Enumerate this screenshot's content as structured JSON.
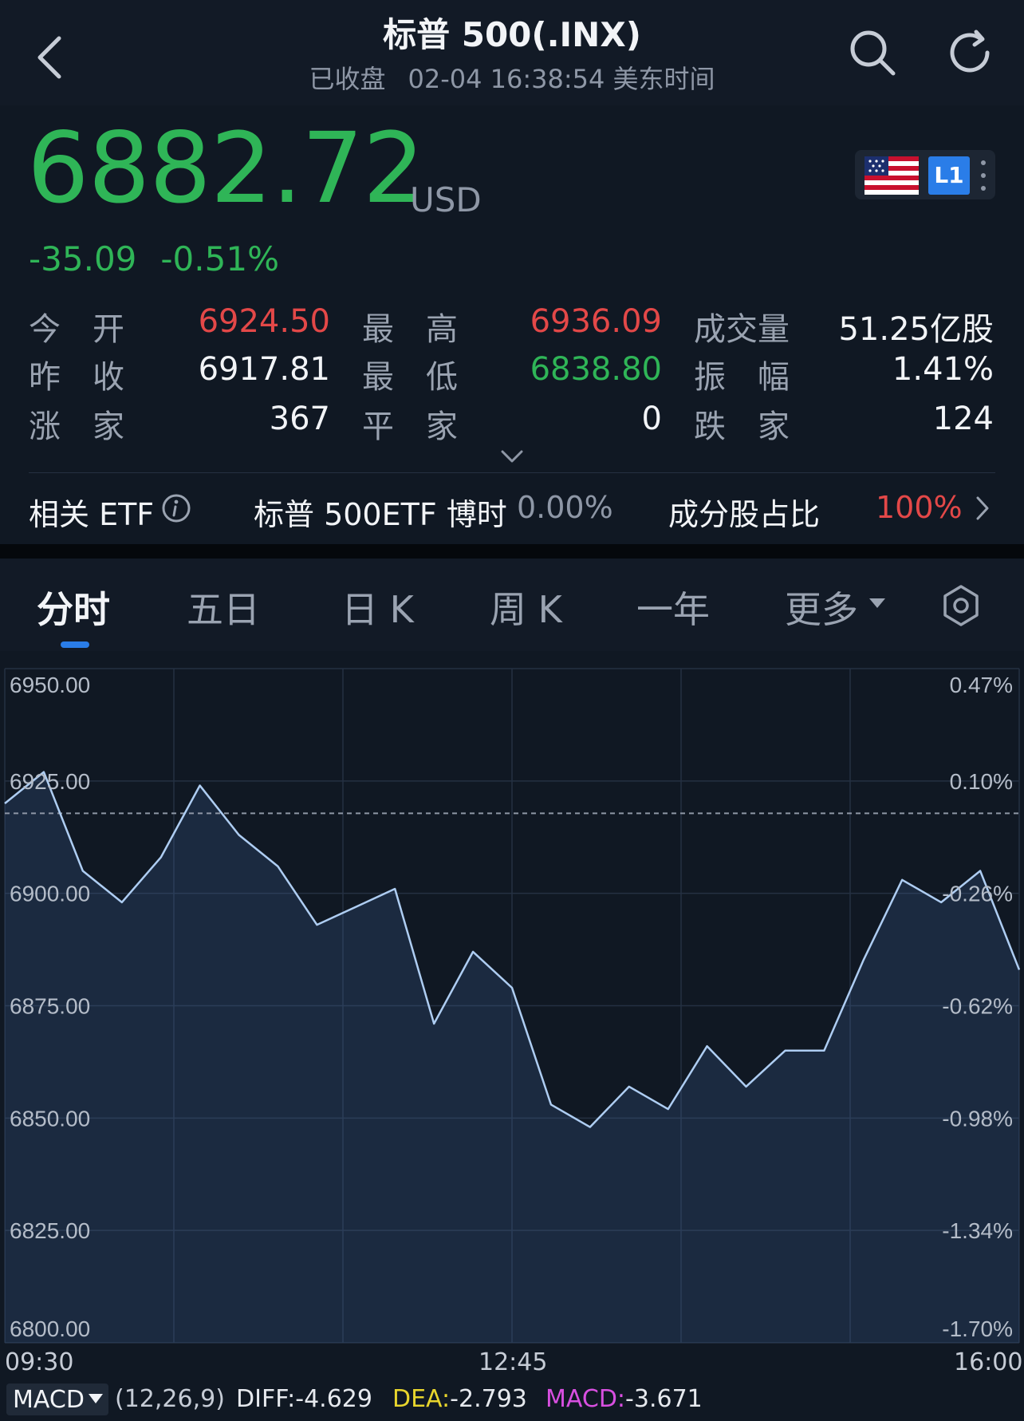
{
  "header": {
    "title": "标普 500(.INX)",
    "status": "已收盘",
    "datetime": "02-04 16:38:54 美东时间"
  },
  "quote": {
    "price": "6882.72",
    "currency": "USD",
    "change": "-35.09",
    "change_pct": "-0.51%",
    "level_badge": "L1"
  },
  "stats": [
    [
      {
        "label": "今　开",
        "value": "6924.50",
        "color": "red"
      },
      {
        "label": "最　高",
        "value": "6936.09",
        "color": "red"
      },
      {
        "label": "成交量",
        "value": "51.25亿股",
        "color": "white"
      }
    ],
    [
      {
        "label": "昨　收",
        "value": "6917.81",
        "color": "white"
      },
      {
        "label": "最　低",
        "value": "6838.80",
        "color": "green"
      },
      {
        "label": "振　幅",
        "value": "1.41%",
        "color": "white"
      }
    ],
    [
      {
        "label": "涨　家",
        "value": "367",
        "color": "white"
      },
      {
        "label": "平　家",
        "value": "0",
        "color": "white"
      },
      {
        "label": "跌　家",
        "value": "124",
        "color": "white"
      }
    ]
  ],
  "etf": {
    "label": "相关 ETF",
    "name": "标普 500ETF 博时",
    "name_pct": "0.00%",
    "weight_label": "成分股占比",
    "weight_value": "100%"
  },
  "tabs": [
    "分时",
    "五日",
    "日 K",
    "周 K",
    "一年",
    "更多"
  ],
  "colors": {
    "up": "#e34848",
    "down": "#2fb557",
    "accent": "#2a7de8",
    "line": "#aecdf2"
  },
  "icons": [
    "back-chevron-icon",
    "search-icon",
    "refresh-icon",
    "us-flag-icon",
    "kebab-icon",
    "chevron-down-icon",
    "info-icon",
    "chevron-right-icon",
    "settings-icon",
    "dropdown-arrow-icon"
  ],
  "chart_data": {
    "type": "line",
    "ylim": [
      6800,
      6950
    ],
    "y_ticks_left": [
      "6950.00",
      "6925.00",
      "6900.00",
      "6875.00",
      "6850.00",
      "6825.00",
      "6800.00"
    ],
    "y_ticks_right": [
      "0.47%",
      "0.10%",
      "-0.26%",
      "-0.62%",
      "-0.98%",
      "-1.34%",
      "-1.70%"
    ],
    "prev_close": 6917.81,
    "x_labels": [
      "09:30",
      "12:45",
      "16:00"
    ],
    "series": [
      {
        "x": [
          "09:30",
          "09:45",
          "10:00",
          "10:15",
          "10:30",
          "10:45",
          "11:00",
          "11:15",
          "11:30",
          "11:45",
          "12:00",
          "12:15",
          "12:30",
          "12:45",
          "13:00",
          "13:15",
          "13:30",
          "13:45",
          "14:00",
          "14:15",
          "14:30",
          "14:45",
          "15:00",
          "15:15",
          "15:30",
          "15:45",
          "16:00"
        ],
        "values": [
          6920,
          6927,
          6905,
          6898,
          6908,
          6924,
          6913,
          6906,
          6893,
          6897,
          6901,
          6871,
          6887,
          6879,
          6853,
          6848,
          6857,
          6852,
          6866,
          6857,
          6865,
          6865,
          6885,
          6903,
          6898,
          6905,
          6883
        ]
      }
    ]
  },
  "macd": {
    "selector": "MACD",
    "params": "(12,26,9)",
    "diff_label": "DIFF:",
    "diff_value": "-4.629",
    "dea_label": "DEA:",
    "dea_value": "-2.793",
    "macd_label": "MACD:",
    "macd_value": "-3.671"
  }
}
